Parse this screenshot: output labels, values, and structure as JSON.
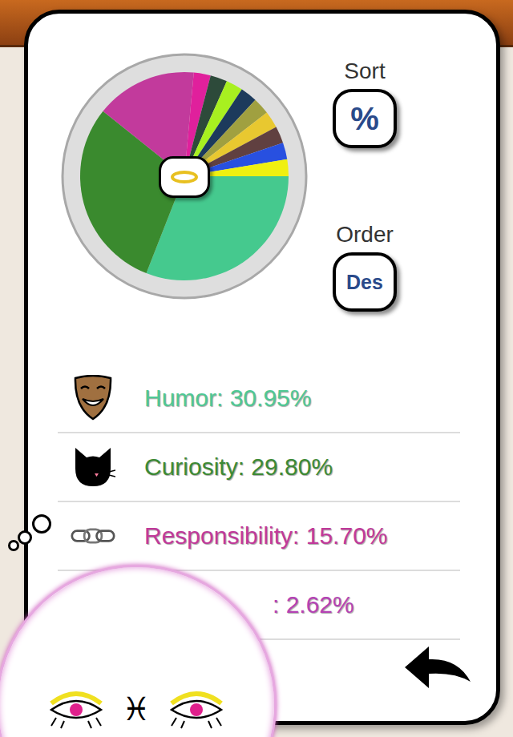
{
  "chart": {
    "slices": [
      {
        "value": 30.95,
        "color": "#45c98e"
      },
      {
        "value": 29.8,
        "color": "#3a8a2e"
      },
      {
        "value": 15.7,
        "color": "#c23a9c"
      },
      {
        "value": 2.62,
        "color": "#e0209c"
      },
      {
        "value": 2.62,
        "color": "#2d4a3a"
      },
      {
        "value": 2.62,
        "color": "#a8f020"
      },
      {
        "value": 2.62,
        "color": "#1c3a5c"
      },
      {
        "value": 2.62,
        "color": "#a0a040"
      },
      {
        "value": 2.62,
        "color": "#e8c830"
      },
      {
        "value": 2.62,
        "color": "#604040"
      },
      {
        "value": 2.62,
        "color": "#2850e0"
      },
      {
        "value": 2.6,
        "color": "#f0f010"
      }
    ]
  },
  "controls": [
    {
      "label": "Sort",
      "value": "%"
    },
    {
      "label": "Order",
      "value": "Des"
    }
  ],
  "traits": [
    {
      "kind": "mask",
      "label": "Humor: 30.95%",
      "color": "#4fc894"
    },
    {
      "kind": "cat",
      "label": "Curiosity: 29.80%",
      "color": "#3d8a35"
    },
    {
      "kind": "chain",
      "label": "Responsibility: 15.70%",
      "color": "#c0399a"
    },
    {
      "kind": "hidden",
      "label": ": 2.62%",
      "color": "#b442b4"
    }
  ],
  "avatar": {
    "sign": "♓"
  }
}
